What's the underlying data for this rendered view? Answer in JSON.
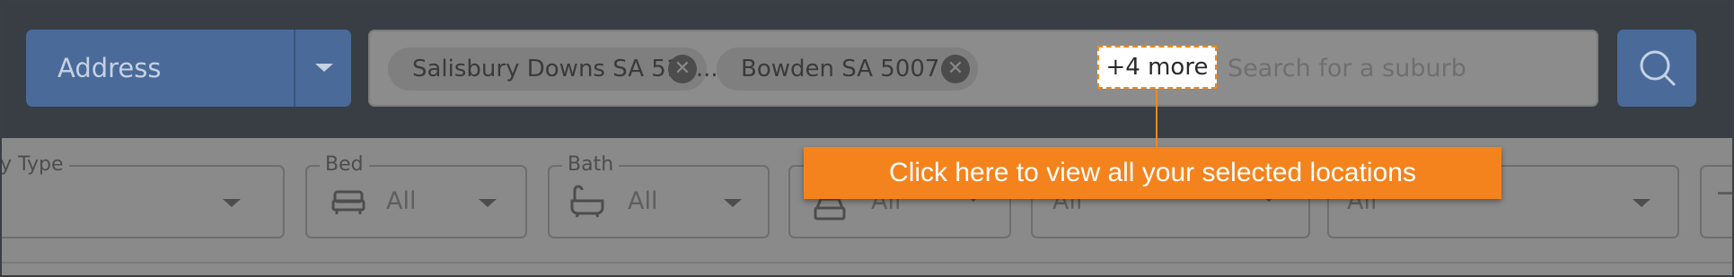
{
  "topbar": {
    "address_dropdown": {
      "label": "Address"
    },
    "search": {
      "chips": [
        {
          "label": "Salisbury Downs SA 510..."
        },
        {
          "label": "Bowden SA 5007"
        }
      ],
      "more_label": "+4 more",
      "placeholder": "Search for a suburb"
    }
  },
  "filters": [
    {
      "label": "y Type",
      "value": "",
      "icon": ""
    },
    {
      "label": "Bed",
      "value": "All",
      "icon": "bed-icon"
    },
    {
      "label": "Bath",
      "value": "All",
      "icon": "bath-icon"
    },
    {
      "label": "",
      "value": "All",
      "icon": "car-icon"
    },
    {
      "label": "",
      "value": "All",
      "icon": ""
    },
    {
      "label": "",
      "value": "All",
      "icon": ""
    }
  ],
  "tooltip": {
    "text": "Click here to view all your selected locations"
  },
  "colors": {
    "accent": "#f5831d",
    "primary_button": "#4a6a9a",
    "topbar": "#383e44"
  }
}
